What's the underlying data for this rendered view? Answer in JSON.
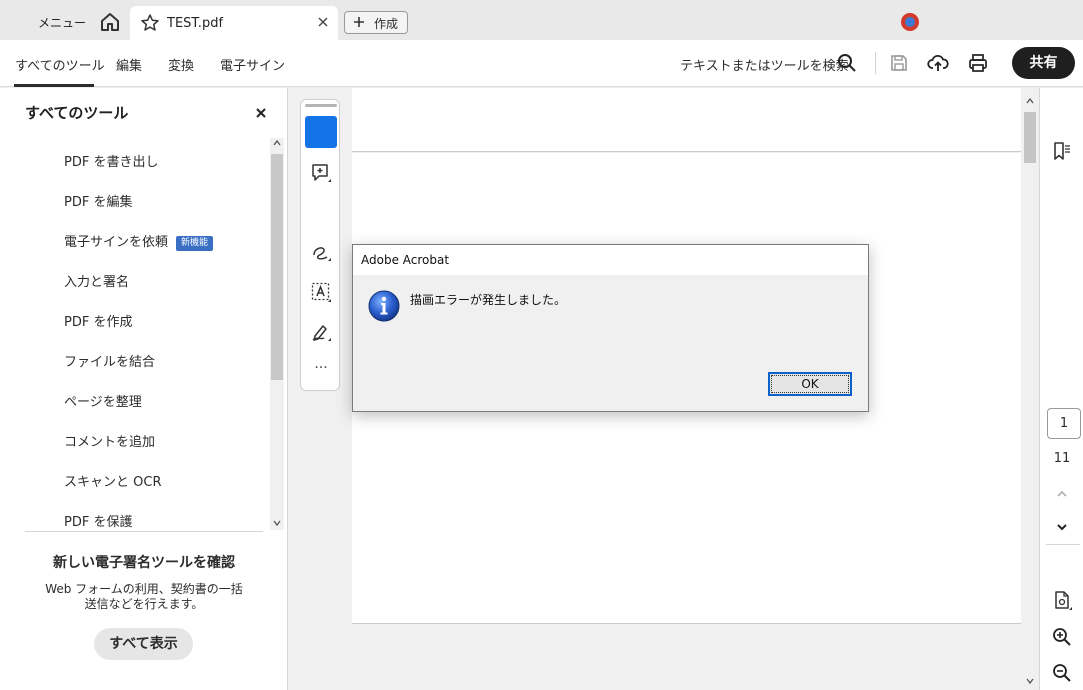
{
  "titlebar": {
    "menu_label": "メニュー",
    "tab_title": "TEST.pdf",
    "create_label": "作成"
  },
  "toolbar": {
    "nav": [
      "すべてのツール",
      "編集",
      "変換",
      "電子サイン"
    ],
    "search_label": "テキストまたはツールを検索",
    "share_label": "共有"
  },
  "left_panel": {
    "title": "すべてのツール",
    "tools": [
      {
        "label": "PDF を書き出し"
      },
      {
        "label": "PDF を編集"
      },
      {
        "label": "電子サインを依頼",
        "badge": "新機能"
      },
      {
        "label": "入力と署名"
      },
      {
        "label": "PDF を作成"
      },
      {
        "label": "ファイルを結合"
      },
      {
        "label": "ページを整理"
      },
      {
        "label": "コメントを追加"
      },
      {
        "label": "スキャンと OCR"
      },
      {
        "label": "PDF を保護"
      }
    ],
    "promo_title": "新しい電子署名ツールを確認",
    "promo_line1": "Web フォームの利用、契約書の一括",
    "promo_line2": "送信などを行えます。",
    "show_all_label": "すべて表示"
  },
  "right_rail": {
    "current_page": "1",
    "total_pages": "11"
  },
  "dialog": {
    "title": "Adobe Acrobat",
    "message": "描画エラーが発生しました。",
    "ok_label": "OK"
  },
  "colors": {
    "accent_blue": "#1473e6",
    "badge_blue": "#3b6fc4",
    "share_button": "#1f1f1f"
  }
}
